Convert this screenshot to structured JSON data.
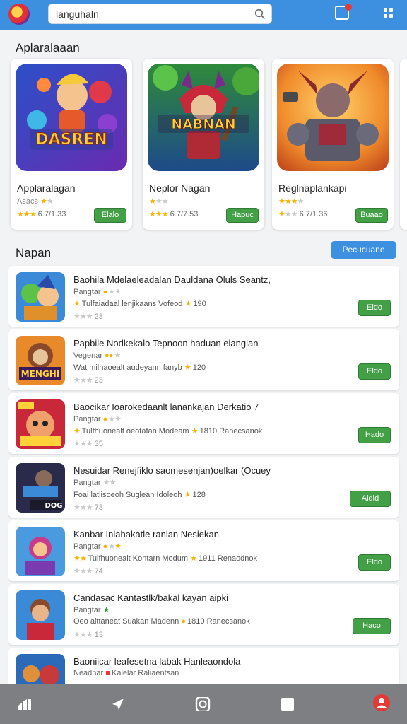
{
  "search": {
    "value": "languhaln"
  },
  "section1": {
    "title": "Aplaralaaan"
  },
  "featured": [
    {
      "name": "Applaralagan",
      "sub": "Asacs",
      "rating": "6.7/1.33",
      "button": "Elalo",
      "art_text": "DASREN"
    },
    {
      "name": "Neplor Nagan",
      "sub": "",
      "rating": "6.7/7.53",
      "button": "Hapuc",
      "art_text": "NABNAN"
    },
    {
      "name": "Reglnaplankapi",
      "sub": "",
      "rating": "6.7/1.36",
      "button": "Buaao",
      "art_text": ""
    }
  ],
  "section2": {
    "title": "Napan",
    "button": "Pecucuane"
  },
  "list": [
    {
      "title": "Baohila Mdelaeleadalan Dauldana Oluls Seantz,",
      "sub": "Pangtar",
      "desc": "Tulfaiadaal lenjikaans Vofeod",
      "count": "190",
      "rating": "23",
      "button": "Eldo"
    },
    {
      "title": "Papbile Nodkekalo Tepnoon haduan elanglan",
      "sub": "Vegenar",
      "desc": "Wat milhaoealt audeyann fanyb",
      "count": "120",
      "rating": "23",
      "button": "Eldo"
    },
    {
      "title": "Baocikar Ioarokedaanlt lanankajan Derkatio 7",
      "sub": "Pangtar",
      "desc": "Tulfhuonealt oeotafan Modeam",
      "count": "1810",
      "count_suffix": "Ranecsanok",
      "rating": "35",
      "button": "Hado"
    },
    {
      "title": "Nesuidar Renejfiklo saomesenjan)oelkar (Ocuey",
      "sub": "Pangtar",
      "desc": "Foai latlisoeoh Suglean Idoleoh",
      "count": "128",
      "rating": "73",
      "button": "Aldid"
    },
    {
      "title": "Kanbar Inlahakatle ranlan Nesiekan",
      "sub": "Pangtar",
      "desc": "Tulfhuonealt Kontarn Modum",
      "count": "1911",
      "count_suffix": "Renaodnok",
      "rating": "74",
      "button": "Eldo"
    },
    {
      "title": "Candasac Kantastlk/bakal kayan aipki",
      "sub": "Pangtar",
      "desc": "Oeo alttaneat Suakan Madenn",
      "count": "1810",
      "count_suffix": "Ranecsanok",
      "rating": "13",
      "button": "Haco"
    },
    {
      "title": "Baoniicar leafesetna labak Hanleaondola",
      "sub": "Neadnar",
      "desc": "Kalelar Raliaentsan",
      "count": "",
      "rating": "",
      "button": ""
    }
  ],
  "colors": {
    "topbar": "#3d8fe0",
    "green": "#43a047",
    "nav": "#7e7f82"
  }
}
